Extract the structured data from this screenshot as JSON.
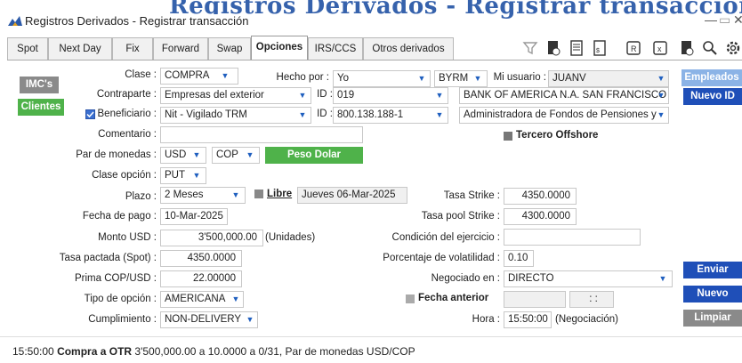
{
  "header": {
    "overlay_title": "Registros Derivados - Registrar transacción",
    "window_title": "Registros Derivados - Registrar transacción"
  },
  "tabs": [
    {
      "label": "Spot"
    },
    {
      "label": "Next Day"
    },
    {
      "label": "Fix"
    },
    {
      "label": "Forward"
    },
    {
      "label": "Swap"
    },
    {
      "label": "Opciones"
    },
    {
      "label": "IRS/CCS"
    },
    {
      "label": "Otros derivados"
    }
  ],
  "form": {
    "clase_label": "Clase :",
    "clase_value": "COMPRA",
    "hecho_por_label": "Hecho por :",
    "hecho_por_value": "Yo",
    "trader_value": "BYRM",
    "mi_usuario_label": "Mi usuario :",
    "mi_usuario_value": "JUANV",
    "contraparte_label": "Contraparte :",
    "contraparte_value": "Empresas del exterior",
    "id_label": "ID :",
    "id_value": "019",
    "contraparte_name": "BANK OF AMERICA N.A. SAN FRANCISCO",
    "beneficiario_label": "Beneficiario :",
    "beneficiario_value": "Nit - Vigilado TRM",
    "id2_label": "ID :",
    "id2_value": "800.138.188-1",
    "beneficiario_name": "Administradora de Fondos de Pensiones y",
    "comentario_label": "Comentario :",
    "comentario_value": "",
    "tercero_label": "Tercero Offshore",
    "par_label": "Par de monedas :",
    "par_base": "USD",
    "par_quote": "COP",
    "clase_opcion_label": "Clase opción :",
    "clase_opcion_value": "PUT",
    "plazo_label": "Plazo :",
    "plazo_value": "2 Meses",
    "libre_label": "Libre",
    "plazo_fecha": "Jueves 06-Mar-2025",
    "tasa_strike_label": "Tasa Strike :",
    "tasa_strike_value": "4350.0000",
    "fecha_pago_label": "Fecha de pago :",
    "fecha_pago_value": "10-Mar-2025",
    "tasa_pool_label": "Tasa pool Strike :",
    "tasa_pool_value": "4300.0000",
    "monto_label": "Monto USD :",
    "monto_value": "3'500,000.00",
    "monto_unit": "(Unidades)",
    "condicion_label": "Condición del ejercicio :",
    "condicion_value": "",
    "tasa_pactada_label": "Tasa pactada (Spot) :",
    "tasa_pactada_value": "4350.0000",
    "volatilidad_label": "Porcentaje de volatilidad :",
    "volatilidad_value": "0.10",
    "prima_label": "Prima COP/USD :",
    "prima_value": "22.00000",
    "negociado_label": "Negociado en :",
    "negociado_value": "DIRECTO",
    "tipo_label": "Tipo de opción :",
    "tipo_value": "AMERICANA",
    "fecha_anterior_label": "Fecha anterior",
    "fecha_anterior_value": "",
    "hora_anterior_value": ": :",
    "cumplimiento_label": "Cumplimiento :",
    "cumplimiento_value": "NON-DELIVERY",
    "hora_label": "Hora :",
    "hora_value": "15:50:00",
    "hora_note": "(Negociación)"
  },
  "buttons": {
    "imcs": "IMC's",
    "clientes": "Clientes",
    "empleados": "Empleados",
    "nuevo_id": "Nuevo ID",
    "peso_dolar": "Peso Dolar",
    "enviar": "Enviar",
    "nuevo": "Nuevo",
    "limpiar": "Limpiar"
  },
  "status": {
    "time": "15:50:00",
    "bold": "Compra a OTR",
    "rest": "3'500,000.00 a 10.0000 a 0/31, Par de monedas USD/COP"
  },
  "colors": {
    "accent": "#1f4fb8",
    "green": "#4fb24a",
    "title_blue": "#2c5aa8"
  }
}
